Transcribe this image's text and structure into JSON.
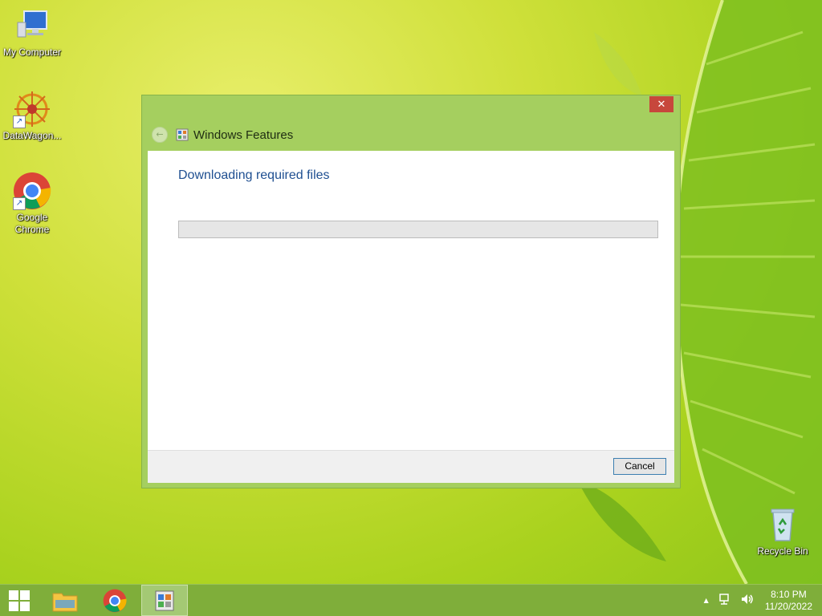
{
  "desktop": {
    "icons": [
      {
        "label": "My Computer"
      },
      {
        "label": "DataWagon..."
      },
      {
        "label": "Google Chrome"
      },
      {
        "label": "Recycle Bin"
      }
    ]
  },
  "dialog": {
    "title": "Windows Features",
    "close_label": "✕",
    "heading": "Downloading required files",
    "progress": 0,
    "cancel_label": "Cancel"
  },
  "taskbar": {
    "clock_time": "8:10 PM",
    "clock_date": "11/20/2022",
    "tray_expand": "▲",
    "colors": {
      "accent": "#7fae3a",
      "progress_fill": "#06b025"
    }
  }
}
